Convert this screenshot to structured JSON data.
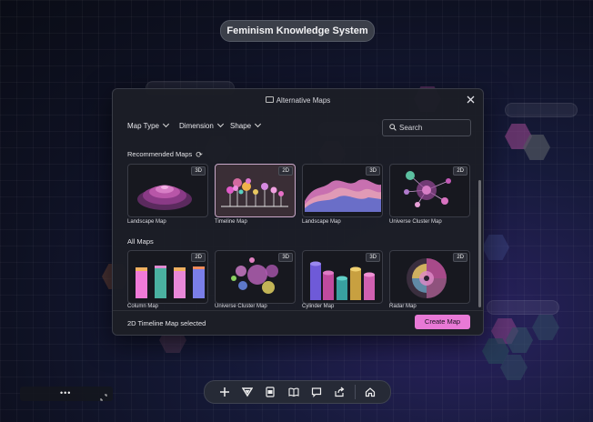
{
  "app": {
    "title": "Feminism Knowledge System"
  },
  "modal": {
    "title": "Alternative Maps",
    "filters": [
      "Map Type",
      "Dimension",
      "Shape"
    ],
    "search_placeholder": "Search",
    "recommended_title": "Recommended Maps",
    "all_title": "All Maps",
    "recommended": [
      {
        "label": "Landscape Map",
        "badge": "3D"
      },
      {
        "label": "Timeline Map",
        "badge": "2D",
        "selected": true
      },
      {
        "label": "Landscape Map",
        "badge": "3D"
      },
      {
        "label": "Universe Cluster Map",
        "badge": "2D"
      }
    ],
    "all": [
      {
        "label": "Column Map",
        "badge": "2D"
      },
      {
        "label": "Universe Cluster Map",
        "badge": "3D"
      },
      {
        "label": "Cylinder Map",
        "badge": "3D"
      },
      {
        "label": "Radar Map",
        "badge": "2D"
      }
    ],
    "footer_status": "2D Timeline Map selected",
    "create_label": "Create Map"
  },
  "toolbar": {
    "tools": [
      "add-icon",
      "filter-triangle-icon",
      "document-icon",
      "book-icon",
      "comment-icon",
      "share-icon",
      "home-icon"
    ]
  },
  "mini_bar": {
    "menu": "•••"
  },
  "colors": {
    "accent": "#e879d6",
    "selected_border": "#c9a9c9"
  }
}
